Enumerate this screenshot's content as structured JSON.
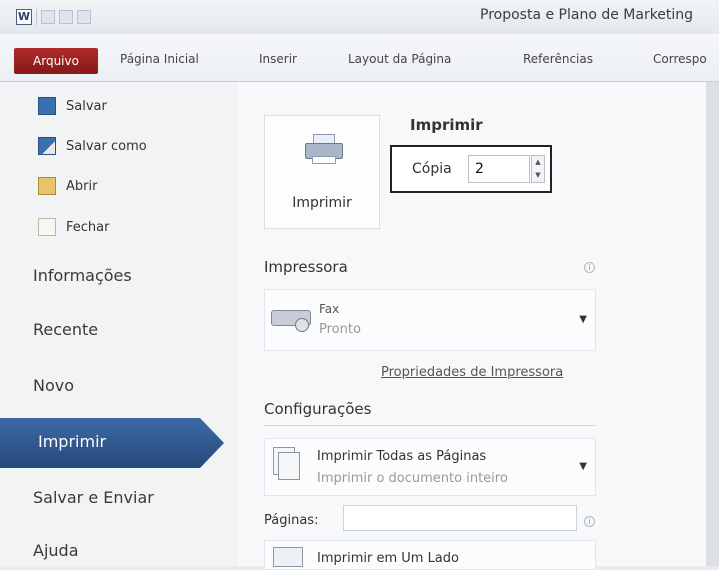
{
  "titlebar": {
    "app_icon_letter": "W",
    "title": "Proposta e Plano de Marketing"
  },
  "ribbon": {
    "file_tab": "Arquivo",
    "tabs": [
      "Página Inicial",
      "Inserir",
      "Layout da Página",
      "Referências",
      "Correspo"
    ]
  },
  "nav": {
    "commands": [
      {
        "label": "Salvar",
        "icon": "save-icon"
      },
      {
        "label": "Salvar como",
        "icon": "save-as-icon"
      },
      {
        "label": "Abrir",
        "icon": "open-folder-icon"
      },
      {
        "label": "Fechar",
        "icon": "close-document-icon"
      }
    ],
    "items": [
      "Informações",
      "Recente",
      "Novo",
      "Imprimir",
      "Salvar e Enviar",
      "Ajuda"
    ],
    "active_item": "Imprimir"
  },
  "print": {
    "heading": "Imprimir",
    "button_label": "Imprimir",
    "copies_label": "Cópia",
    "copies_value": "2"
  },
  "printer": {
    "heading": "Impressora",
    "name": "Fax",
    "status": "Pronto",
    "properties_link": "Propriedades de Impressora"
  },
  "settings": {
    "heading": "Configurações",
    "pages_option_title": "Imprimir Todas as Páginas",
    "pages_option_desc": "Imprimir o documento inteiro",
    "pages_label": "Páginas:",
    "pages_value": "",
    "sides_option_title": "Imprimir em Um Lado"
  },
  "colors": {
    "file_tab": "#a32020",
    "active_nav": "#2f5a92"
  }
}
